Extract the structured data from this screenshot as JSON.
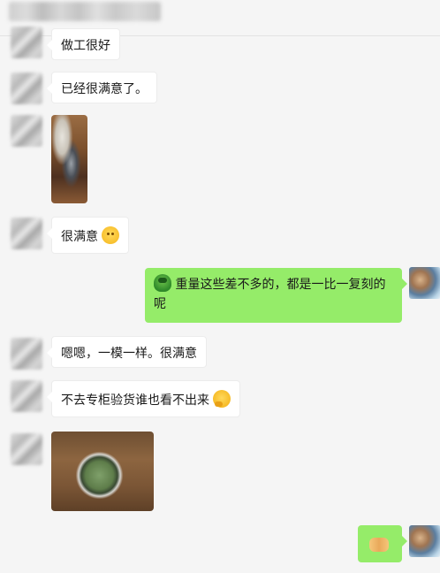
{
  "colors": {
    "background": "#f5f5f5",
    "self_bubble": "#95ec69",
    "other_bubble": "#ffffff"
  },
  "messages": [
    {
      "side": "left",
      "text": "做工很好"
    },
    {
      "side": "left",
      "text": "已经很满意了。"
    },
    {
      "side": "left",
      "type": "image"
    },
    {
      "side": "left",
      "text": "很满意",
      "emoji": "smile-icon"
    },
    {
      "side": "right",
      "emoji": "turtle-icon",
      "text_line1": "重量这些差不多的，都是一比一复刻的",
      "text_line2": "呢"
    },
    {
      "side": "left",
      "text": "嗯嗯，一模一样。很满意"
    },
    {
      "side": "left",
      "text": "不去专柜验货谁也看不出来",
      "emoji": "thinking-icon"
    },
    {
      "side": "left",
      "type": "image"
    },
    {
      "side": "right",
      "emoji": "handshake-icon"
    }
  ]
}
